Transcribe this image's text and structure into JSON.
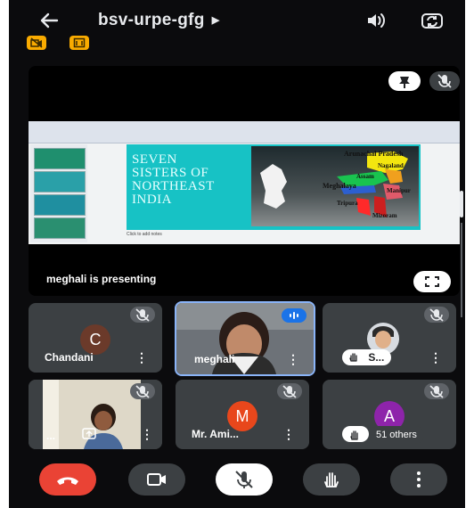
{
  "meeting": {
    "code": "bsv-urpe-gfg"
  },
  "icons": {
    "back": "arrow-left-icon",
    "speaker": "speaker-icon",
    "switch_camera": "switch-camera-icon",
    "pin": "pin-icon",
    "fullscreen": "fullscreen-icon",
    "mic_off": "mic-off-icon",
    "raise_hand": "raise-hand-icon",
    "end_call": "phone-hangup-icon",
    "camera": "video-camera-icon",
    "more": "more-vertical-icon"
  },
  "colors": {
    "background": "#0b0b0d",
    "tile": "#3c4043",
    "end_call": "#ea4335",
    "badge": "#f9ab00",
    "active_border": "#8ab4f8"
  },
  "presentation": {
    "status": "meghali is presenting",
    "slide": {
      "title_lines": [
        "SEVEN",
        "SISTERS OF",
        "NORTHEAST",
        "INDIA"
      ],
      "map_labels": [
        "Arunachal Pradesh",
        "Nagaland",
        "Assam",
        "Meghalaya",
        "Manipur",
        "Tripura",
        "Mizoram"
      ],
      "notes": "Click to add notes"
    }
  },
  "participants": [
    {
      "name": "Chandani",
      "initial": "C",
      "avatar_color": "#6b3a2a",
      "muted": true
    },
    {
      "name": "meghali",
      "speaking": true
    },
    {
      "name": "S...",
      "hand_raised": true,
      "muted": true
    },
    {
      "name": "...",
      "muted": true
    },
    {
      "name": "Mr. Ami...",
      "initial": "M",
      "avatar_color": "#e8471c",
      "muted": true
    },
    {
      "name": "51 others",
      "initial": "A",
      "avatar_color": "#8e24aa",
      "muted": true
    }
  ]
}
